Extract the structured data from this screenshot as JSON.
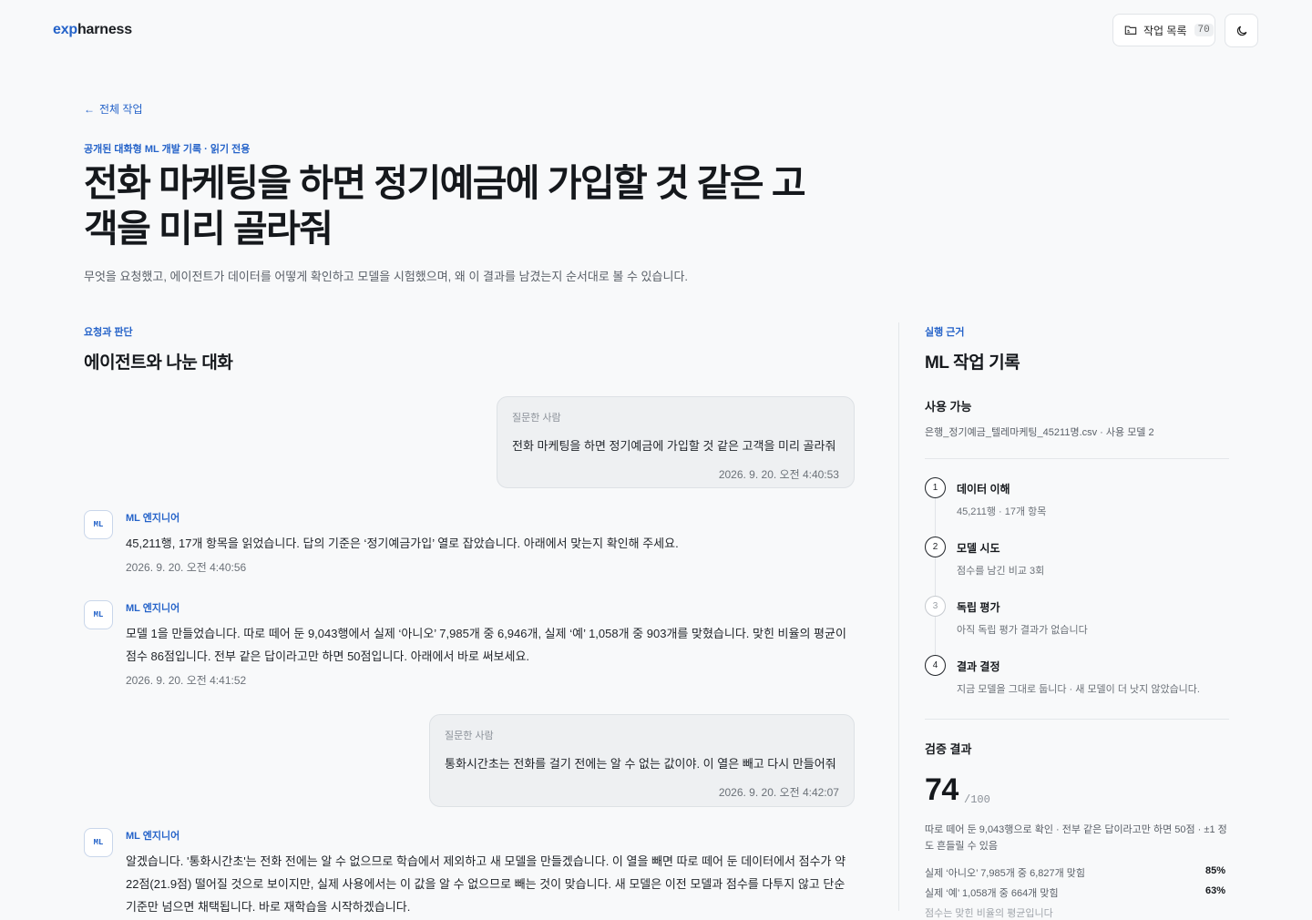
{
  "header": {
    "logo_exp": "exp",
    "logo_harness": "harness",
    "jobs_label": "작업 목록",
    "jobs_count": "70"
  },
  "page": {
    "back_label": "전체 작업",
    "eyebrow": "공개된 대화형 ML 개발 기록 · 읽기 전용",
    "title": "전화 마케팅을 하면 정기예금에 가입할 것 같은 고객을 미리 골라줘",
    "subtitle": "무엇을 요청했고, 에이전트가 데이터를 어떻게 확인하고 모델을 시험했으며, 왜 이 결과를 남겼는지 순서대로 볼 수 있습니다."
  },
  "conversation": {
    "eyebrow": "요청과 판단",
    "title": "에이전트와 나눈 대화",
    "messages": [
      {
        "who": "질문한 사람",
        "text": "전화 마케팅을 하면 정기예금에 가입할 것 같은 고객을 미리 골라줘",
        "time": "2026. 9. 20. 오전 4:40:53"
      },
      {
        "who": "ML 엔지니어",
        "avatar": "ML",
        "text": "45,211행, 17개 항목을 읽었습니다. 답의 기준은 ‘정기예금가입’ 열로 잡았습니다. 아래에서 맞는지 확인해 주세요.",
        "time": "2026. 9. 20. 오전 4:40:56"
      },
      {
        "who": "ML 엔지니어",
        "avatar": "ML",
        "text": "모델 1을 만들었습니다. 따로 떼어 둔 9,043행에서 실제 ‘아니오’ 7,985개 중 6,946개, 실제 ‘예’ 1,058개 중 903개를 맞혔습니다. 맞힌 비율의 평균이 점수 86점입니다. 전부 같은 답이라고만 하면 50점입니다. 아래에서 바로 써보세요.",
        "time": "2026. 9. 20. 오전 4:41:52"
      },
      {
        "who": "질문한 사람",
        "text": "통화시간초는 전화를 걸기 전에는 알 수 없는 값이야. 이 열은 빼고 다시 만들어줘",
        "time": "2026. 9. 20. 오전 4:42:07"
      },
      {
        "who": "ML 엔지니어",
        "avatar": "ML",
        "text": "알겠습니다. '통화시간초'는 전화 전에는 알 수 없으므로 학습에서 제외하고 새 모델을 만들겠습니다. 이 열을 빼면 따로 떼어 둔 데이터에서 점수가 약 22점(21.9점) 떨어질 것으로 보이지만, 실제 사용에서는 이 값을 알 수 없으므로 빼는 것이 맞습니다. 새 모델은 이전 모델과 점수를 다투지 않고 단순 기준만 넘으면 채택됩니다. 바로 재학습을 시작하겠습니다.",
        "time": ""
      }
    ]
  },
  "record": {
    "eyebrow": "실행 근거",
    "title": "ML 작업 기록",
    "usable_title": "사용 가능",
    "usable_sub": "은행_정기예금_텔레마케팅_45211명.csv · 사용 모델 2",
    "steps": [
      {
        "num": "1",
        "label": "데이터 이해",
        "desc": "45,211행 · 17개 항목"
      },
      {
        "num": "2",
        "label": "모델 시도",
        "desc": "점수를 남긴 비교 3회"
      },
      {
        "num": "3",
        "label": "독립 평가",
        "desc": "아직 독립 평가 결과가 없습니다"
      },
      {
        "num": "4",
        "label": "결과 결정",
        "desc": "지금 모델을 그대로 둡니다 · 새 모델이 더 낫지 않았습니다."
      }
    ],
    "verify_title": "검증 결과",
    "score": "74",
    "score_max": "/100",
    "score_note": "따로 떼어 둔 9,043행으로 확인 · 전부 같은 답이라고만 하면 50점 · ±1 정도 흔들릴 수 있음",
    "metrics": [
      {
        "label": "실제 ‘아니오’ 7,985개 중 6,827개 맞힘",
        "pct": "85%"
      },
      {
        "label": "실제 ‘예’ 1,058개 중 664개 맞힘",
        "pct": "63%"
      }
    ],
    "fade_text": "점수는 맞힌 비율의 평균입니다"
  }
}
